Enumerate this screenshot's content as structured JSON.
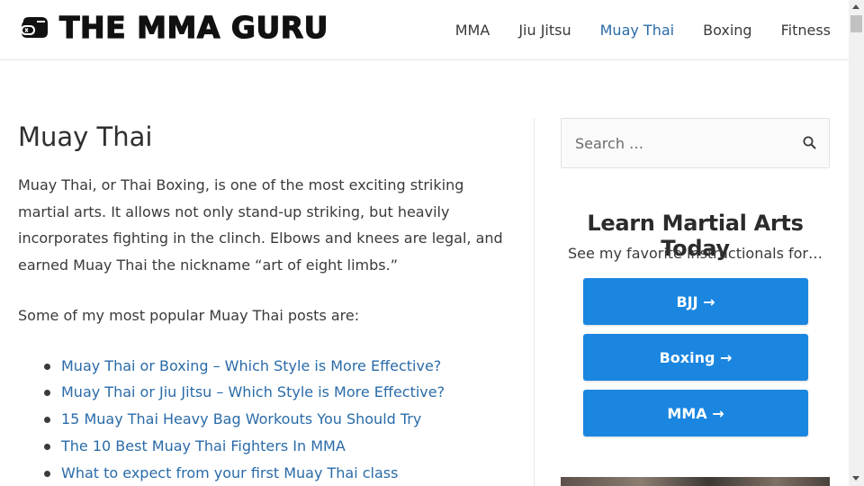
{
  "header": {
    "logo_text": "THE MMA GURU",
    "logo_icon": "boxing-glove-icon",
    "nav": [
      {
        "label": "MMA",
        "active": false
      },
      {
        "label": "Jiu Jitsu",
        "active": false
      },
      {
        "label": "Muay Thai",
        "active": true
      },
      {
        "label": "Boxing",
        "active": false
      },
      {
        "label": "Fitness",
        "active": false
      }
    ]
  },
  "main": {
    "title": "Muay Thai",
    "intro": "Muay Thai, or Thai Boxing, is one of the most exciting striking martial arts. It allows not only stand-up striking, but heavily incorporates fighting in the clinch. Elbows and knees are legal, and earned Muay Thai the nickname “art of eight limbs.”",
    "lead": "Some of my most popular Muay Thai posts are:",
    "posts": [
      "Muay Thai or Boxing – Which Style is More Effective?",
      "Muay Thai or Jiu Jitsu – Which Style is More Effective?",
      "15 Muay Thai Heavy Bag Workouts You Should Try",
      "The 10 Best Muay Thai Fighters In MMA",
      "What to expect from your first Muay Thai class"
    ]
  },
  "sidebar": {
    "search": {
      "placeholder": "Search …",
      "icon": "search-icon"
    },
    "widget_title": "Learn Martial Arts Today",
    "widget_subtitle": "See my favorite instructionals for…",
    "buttons": [
      {
        "label": "BJJ →"
      },
      {
        "label": "Boxing →"
      },
      {
        "label": "MMA →"
      }
    ]
  },
  "colors": {
    "accent_link": "#2a6ba8",
    "button_blue": "#1a86e0",
    "text": "#3a3a3a"
  }
}
